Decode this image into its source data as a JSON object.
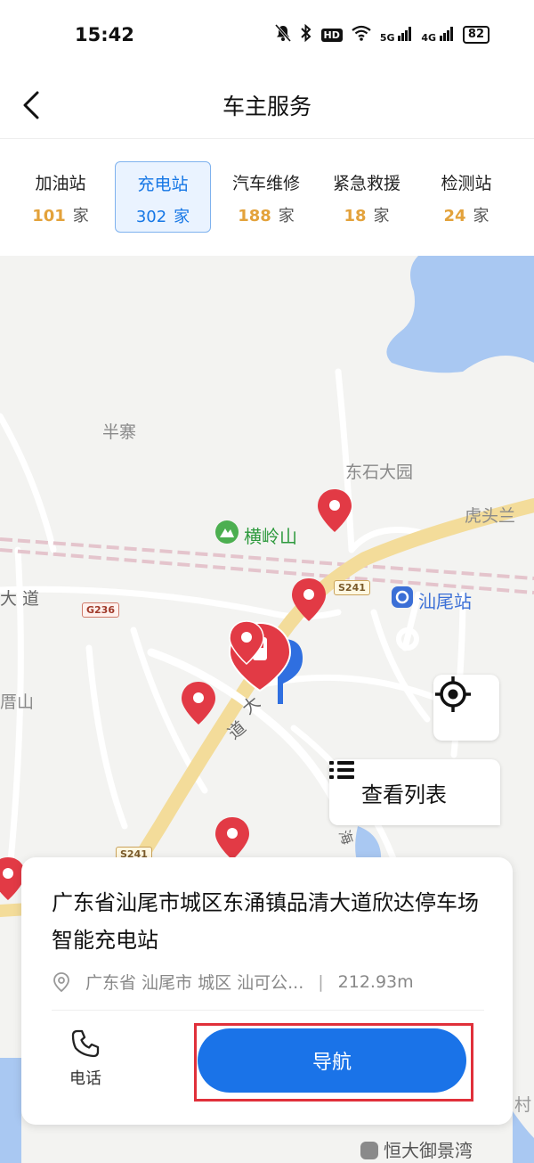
{
  "status_bar": {
    "time": "15:42",
    "icons": [
      "mute-bell-icon",
      "bluetooth-icon",
      "hd-icon",
      "wifi-icon",
      "5g-signal-icon",
      "4g-signal-icon"
    ],
    "hd_label": "HD",
    "sig1_label": "5G",
    "sig2_label": "4G",
    "battery": "82"
  },
  "header": {
    "title": "车主服务",
    "back_icon": "chevron-left-icon"
  },
  "tabs": [
    {
      "name": "加油站",
      "count": "101",
      "unit": "家",
      "active": false
    },
    {
      "name": "充电站",
      "count": "302",
      "unit": "家",
      "active": true
    },
    {
      "name": "汽车维修",
      "count": "188",
      "unit": "家",
      "active": false
    },
    {
      "name": "紧急救援",
      "count": "18",
      "unit": "家",
      "active": false
    },
    {
      "name": "检测站",
      "count": "24",
      "unit": "家",
      "active": false
    }
  ],
  "map": {
    "labels": {
      "banzhai": "半寨",
      "dongshi": "东石大园",
      "hutoulan": "虎头兰",
      "hengling": "横岭山",
      "dadao_left": "大 道",
      "shanwei_station": "汕尾站",
      "shan_left": "厝山",
      "road_vertical_1": "大",
      "road_vertical_2": "道",
      "hengyu": "恒大御景湾",
      "cun": "村",
      "hai": "海"
    },
    "road_badges": {
      "s241_top": "S241",
      "g236": "G236",
      "s241_bottom": "S241"
    },
    "locate_icon": "crosshair-icon",
    "list_button": {
      "icon": "list-icon",
      "label": "查看列表"
    }
  },
  "station_card": {
    "name": "广东省汕尾市城区东涌镇品清大道欣达停车场智能充电站",
    "address": "广东省 汕尾市 城区 汕可公...",
    "separator": "|",
    "distance": "212.93m",
    "phone_label": "电话",
    "navigate_label": "导航"
  },
  "colors": {
    "accent": "#1a73e8",
    "count_orange": "#e3a23b",
    "pin_red": "#e23a45",
    "highlight_red": "#e0303a"
  }
}
